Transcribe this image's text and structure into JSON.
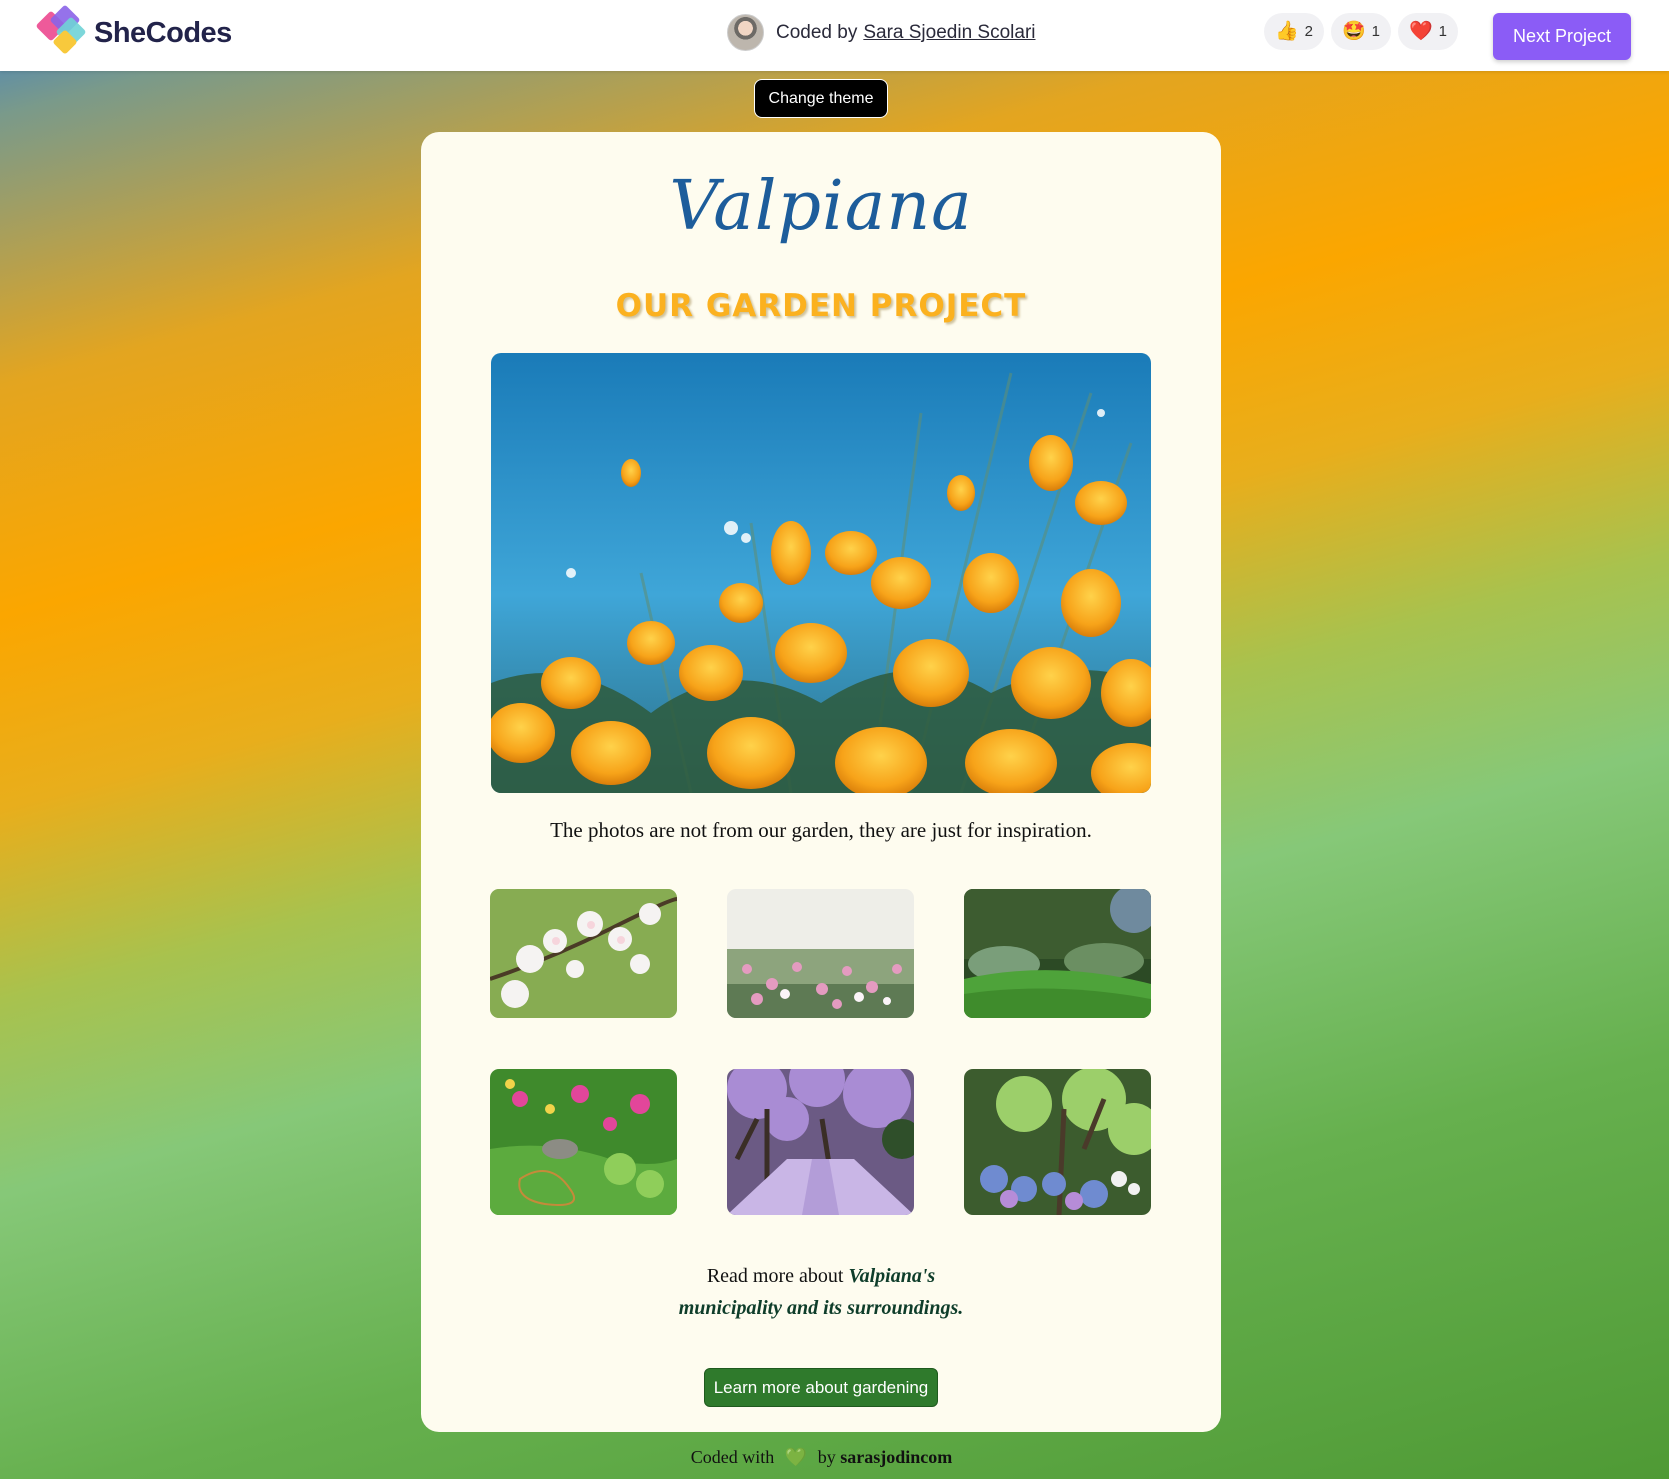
{
  "header": {
    "brand": "SheCodes",
    "coded_by_prefix": "Coded by",
    "coder_name": "Sara Sjoedin Scolari",
    "reactions": [
      {
        "icon": "thumbs-up",
        "glyph": "👍",
        "count": "2"
      },
      {
        "icon": "star-struck",
        "glyph": "🤩",
        "count": "1"
      },
      {
        "icon": "heart",
        "glyph": "❤️",
        "count": "1"
      }
    ],
    "next_button": "Next Project"
  },
  "theme_button": "Change theme",
  "card": {
    "title": "Valpiana",
    "subtitle": "OUR GARDEN PROJECT",
    "caption": "The photos are not from our garden, they are just for inspiration.",
    "gallery": [
      "white blossom branch",
      "pink cosmos meadow",
      "green lawn with hostas",
      "flower beds with hose",
      "jacaranda tree alley",
      "lush garden with hydrangeas"
    ],
    "read_more_prefix": "Read more about",
    "read_more_link_1": "Valpiana's",
    "read_more_link_2": "municipality and its surroundings.",
    "learn_button": "Learn more about gardening"
  },
  "footer": {
    "prefix": "Coded with",
    "heart": "💚",
    "by": "by",
    "author": "sarasjodincom"
  },
  "colors": {
    "accent": "#8b5cf6",
    "title": "#1d5d9b",
    "subtitle": "#fbb11f",
    "learn_button": "#2f7a2c",
    "card_bg": "#fefcef"
  }
}
